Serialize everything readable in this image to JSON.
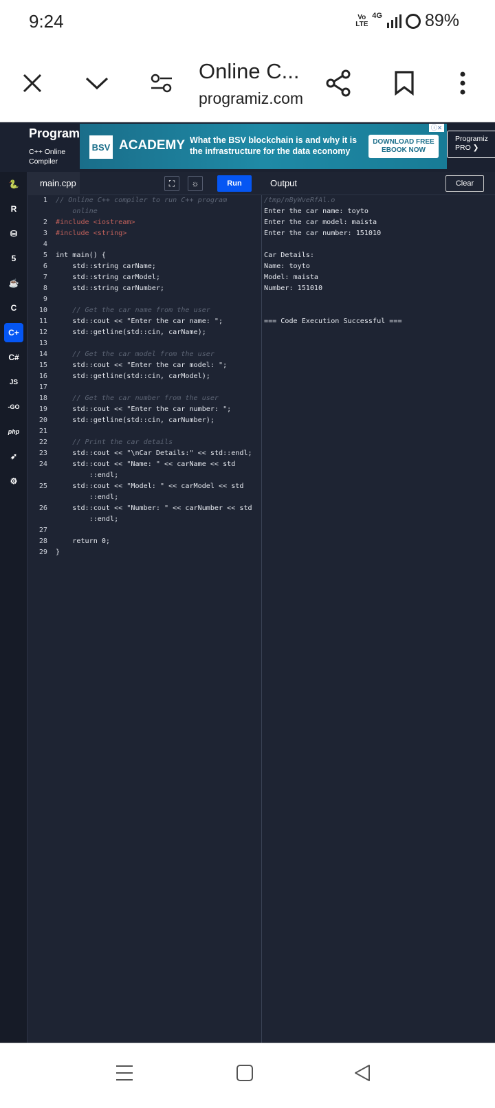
{
  "status_bar": {
    "time": "9:24",
    "network_top": "Vo",
    "network_bottom": "LTE",
    "signal_label": "4G",
    "battery": "89%"
  },
  "browser": {
    "title": "Online C...",
    "url": "programiz.com",
    "icons": [
      "close-icon",
      "chevron-down-icon",
      "settings-sliders-icon",
      "share-icon",
      "bookmark-icon",
      "more-vert-icon"
    ]
  },
  "site": {
    "logo": "Programiz",
    "logo_sub_1": "C++ Online",
    "logo_sub_2": "Compiler",
    "pro_1": "Programiz",
    "pro_2": "PRO ❯"
  },
  "ad": {
    "bsv": "BSV",
    "academy": "ACADEMY",
    "line1": "What the BSV blockchain is and why it is",
    "line2": "the infrastructure for the data economy",
    "cta1": "DOWNLOAD FREE",
    "cta2": "EBOOK NOW"
  },
  "editor": {
    "file": "main.cpp",
    "run": "Run",
    "output_title": "Output",
    "clear": "Clear"
  },
  "languages": [
    "python",
    "r",
    "sql",
    "html",
    "java",
    "c",
    "cpp",
    "csharp",
    "JS",
    "GO",
    "php",
    "swift",
    "rust"
  ],
  "code_lines": [
    {
      "n": "1",
      "t": "// Online C++ compiler to run C++ program",
      "c": "cmt"
    },
    {
      "n": "",
      "t": "    online",
      "c": "cmt"
    },
    {
      "n": "2",
      "t": "#include <iostream>",
      "c": "inc"
    },
    {
      "n": "3",
      "t": "#include <string>",
      "c": "inc"
    },
    {
      "n": "4",
      "t": "",
      "c": ""
    },
    {
      "n": "5",
      "t": "int main() {",
      "c": ""
    },
    {
      "n": "6",
      "t": "    std::string carName;",
      "c": ""
    },
    {
      "n": "7",
      "t": "    std::string carModel;",
      "c": ""
    },
    {
      "n": "8",
      "t": "    std::string carNumber;",
      "c": ""
    },
    {
      "n": "9",
      "t": "",
      "c": ""
    },
    {
      "n": "10",
      "t": "    // Get the car name from the user",
      "c": "cmt"
    },
    {
      "n": "11",
      "t": "    std::cout << \"Enter the car name: \";",
      "c": ""
    },
    {
      "n": "12",
      "t": "    std::getline(std::cin, carName);",
      "c": ""
    },
    {
      "n": "13",
      "t": "",
      "c": ""
    },
    {
      "n": "14",
      "t": "    // Get the car model from the user",
      "c": "cmt"
    },
    {
      "n": "15",
      "t": "    std::cout << \"Enter the car model: \";",
      "c": ""
    },
    {
      "n": "16",
      "t": "    std::getline(std::cin, carModel);",
      "c": ""
    },
    {
      "n": "17",
      "t": "",
      "c": ""
    },
    {
      "n": "18",
      "t": "    // Get the car number from the user",
      "c": "cmt"
    },
    {
      "n": "19",
      "t": "    std::cout << \"Enter the car number: \";",
      "c": ""
    },
    {
      "n": "20",
      "t": "    std::getline(std::cin, carNumber);",
      "c": ""
    },
    {
      "n": "21",
      "t": "",
      "c": ""
    },
    {
      "n": "22",
      "t": "    // Print the car details",
      "c": "cmt"
    },
    {
      "n": "23",
      "t": "    std::cout << \"\\nCar Details:\" << std::endl;",
      "c": ""
    },
    {
      "n": "24",
      "t": "    std::cout << \"Name: \" << carName << std",
      "c": ""
    },
    {
      "n": "",
      "t": "        ::endl;",
      "c": ""
    },
    {
      "n": "25",
      "t": "    std::cout << \"Model: \" << carModel << std",
      "c": ""
    },
    {
      "n": "",
      "t": "        ::endl;",
      "c": ""
    },
    {
      "n": "26",
      "t": "    std::cout << \"Number: \" << carNumber << std",
      "c": ""
    },
    {
      "n": "",
      "t": "        ::endl;",
      "c": ""
    },
    {
      "n": "27",
      "t": "",
      "c": ""
    },
    {
      "n": "28",
      "t": "    return 0;",
      "c": ""
    },
    {
      "n": "29",
      "t": "}",
      "c": ""
    }
  ],
  "output_lines": [
    {
      "t": "/tmp/nByWveRfAl.o",
      "c": "path"
    },
    {
      "t": "Enter the car name: toyto",
      "c": ""
    },
    {
      "t": "Enter the car model: maista",
      "c": ""
    },
    {
      "t": "Enter the car number: 151010",
      "c": ""
    },
    {
      "t": "",
      "c": ""
    },
    {
      "t": "Car Details:",
      "c": ""
    },
    {
      "t": "Name: toyto",
      "c": ""
    },
    {
      "t": "Model: maista",
      "c": ""
    },
    {
      "t": "Number: 151010",
      "c": ""
    },
    {
      "t": "",
      "c": ""
    },
    {
      "t": "",
      "c": ""
    },
    {
      "t": "=== Code Execution Successful ===",
      "c": ""
    }
  ],
  "nav": [
    "recent-apps-icon",
    "home-icon",
    "back-icon"
  ]
}
